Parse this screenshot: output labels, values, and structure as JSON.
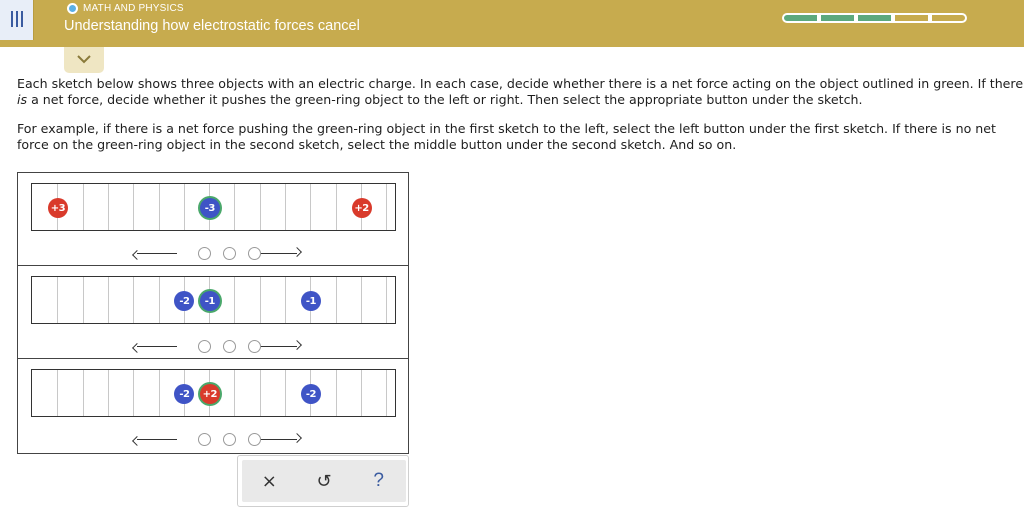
{
  "header": {
    "subject": "MATH AND PHYSICS",
    "title": "Understanding how electrostatic forces cancel",
    "progress": {
      "filled_segments": 3,
      "total_segments": 5,
      "filled_color": "#5ca97e"
    },
    "menu_icon": "hamburger-icon",
    "collapse_icon": "chevron-down-icon"
  },
  "instructions": {
    "paragraph1_a": "Each sketch below shows three objects with an electric charge. In each case, decide whether there is a net force acting on the object outlined in green. If there ",
    "paragraph1_em": "is",
    "paragraph1_b": " a net force, decide whether it pushes the green-ring object to the left or right. Then select the appropriate button under the sketch.",
    "paragraph2": "For example, if there is a net force pushing the green-ring object in the first sketch to the left, select the left button under the first sketch. If there is no net force on the green-ring object in the second sketch, select the middle button under the second sketch. And so on."
  },
  "sketches": [
    {
      "charges": [
        {
          "label": "+3",
          "sign": "pos",
          "target": false,
          "cell": 1
        },
        {
          "label": "-3",
          "sign": "neg",
          "target": true,
          "cell": 7
        },
        {
          "label": "+2",
          "sign": "pos",
          "target": false,
          "cell": 13
        }
      ]
    },
    {
      "charges": [
        {
          "label": "-2",
          "sign": "neg",
          "target": false,
          "cell": 6
        },
        {
          "label": "-1",
          "sign": "neg",
          "target": true,
          "cell": 7
        },
        {
          "label": "-1",
          "sign": "neg",
          "target": false,
          "cell": 11
        }
      ]
    },
    {
      "charges": [
        {
          "label": "-2",
          "sign": "neg",
          "target": false,
          "cell": 6
        },
        {
          "label": "+2",
          "sign": "pos",
          "target": true,
          "cell": 7
        },
        {
          "label": "-2",
          "sign": "neg",
          "target": false,
          "cell": 11
        }
      ]
    }
  ],
  "colors": {
    "header": "#c7ab4e",
    "positive": "#d93a2b",
    "negative": "#3f54c6",
    "target_ring": "#4aa86b"
  },
  "toolbar": {
    "clear_label": "×",
    "undo_label": "↺",
    "help_label": "?"
  }
}
